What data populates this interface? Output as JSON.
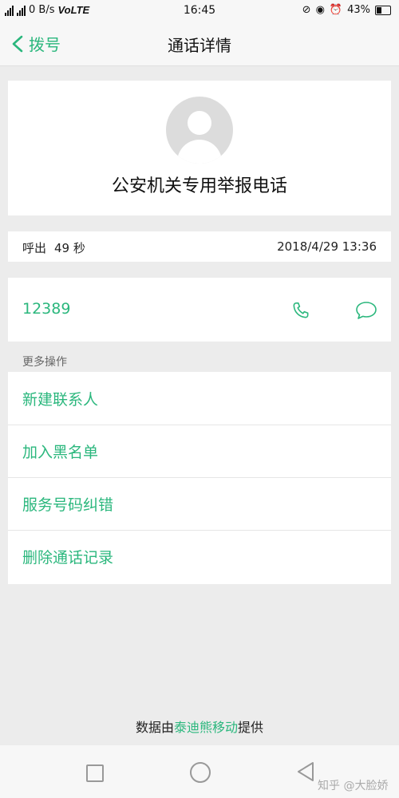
{
  "statusbar": {
    "net_speed": "0 B/s",
    "volte": "VoLTE",
    "time": "16:45",
    "battery": "43%",
    "net_tag": "4G"
  },
  "header": {
    "back_label": "拨号",
    "title": "通话详情"
  },
  "contact": {
    "name": "公安机关专用举报电话"
  },
  "call": {
    "direction": "呼出",
    "duration": "49 秒",
    "datetime": "2018/4/29 13:36"
  },
  "number": {
    "value": "12389"
  },
  "more": {
    "label": "更多操作",
    "items": [
      {
        "label": "新建联系人"
      },
      {
        "label": "加入黑名单"
      },
      {
        "label": "服务号码纠错"
      },
      {
        "label": "删除通话记录"
      }
    ]
  },
  "footer": {
    "prefix": "数据由",
    "provider": "泰迪熊移动",
    "suffix": "提供"
  },
  "watermark": "知乎 @大脸娇",
  "colors": {
    "accent": "#2bb77d",
    "background": "#ececec"
  }
}
